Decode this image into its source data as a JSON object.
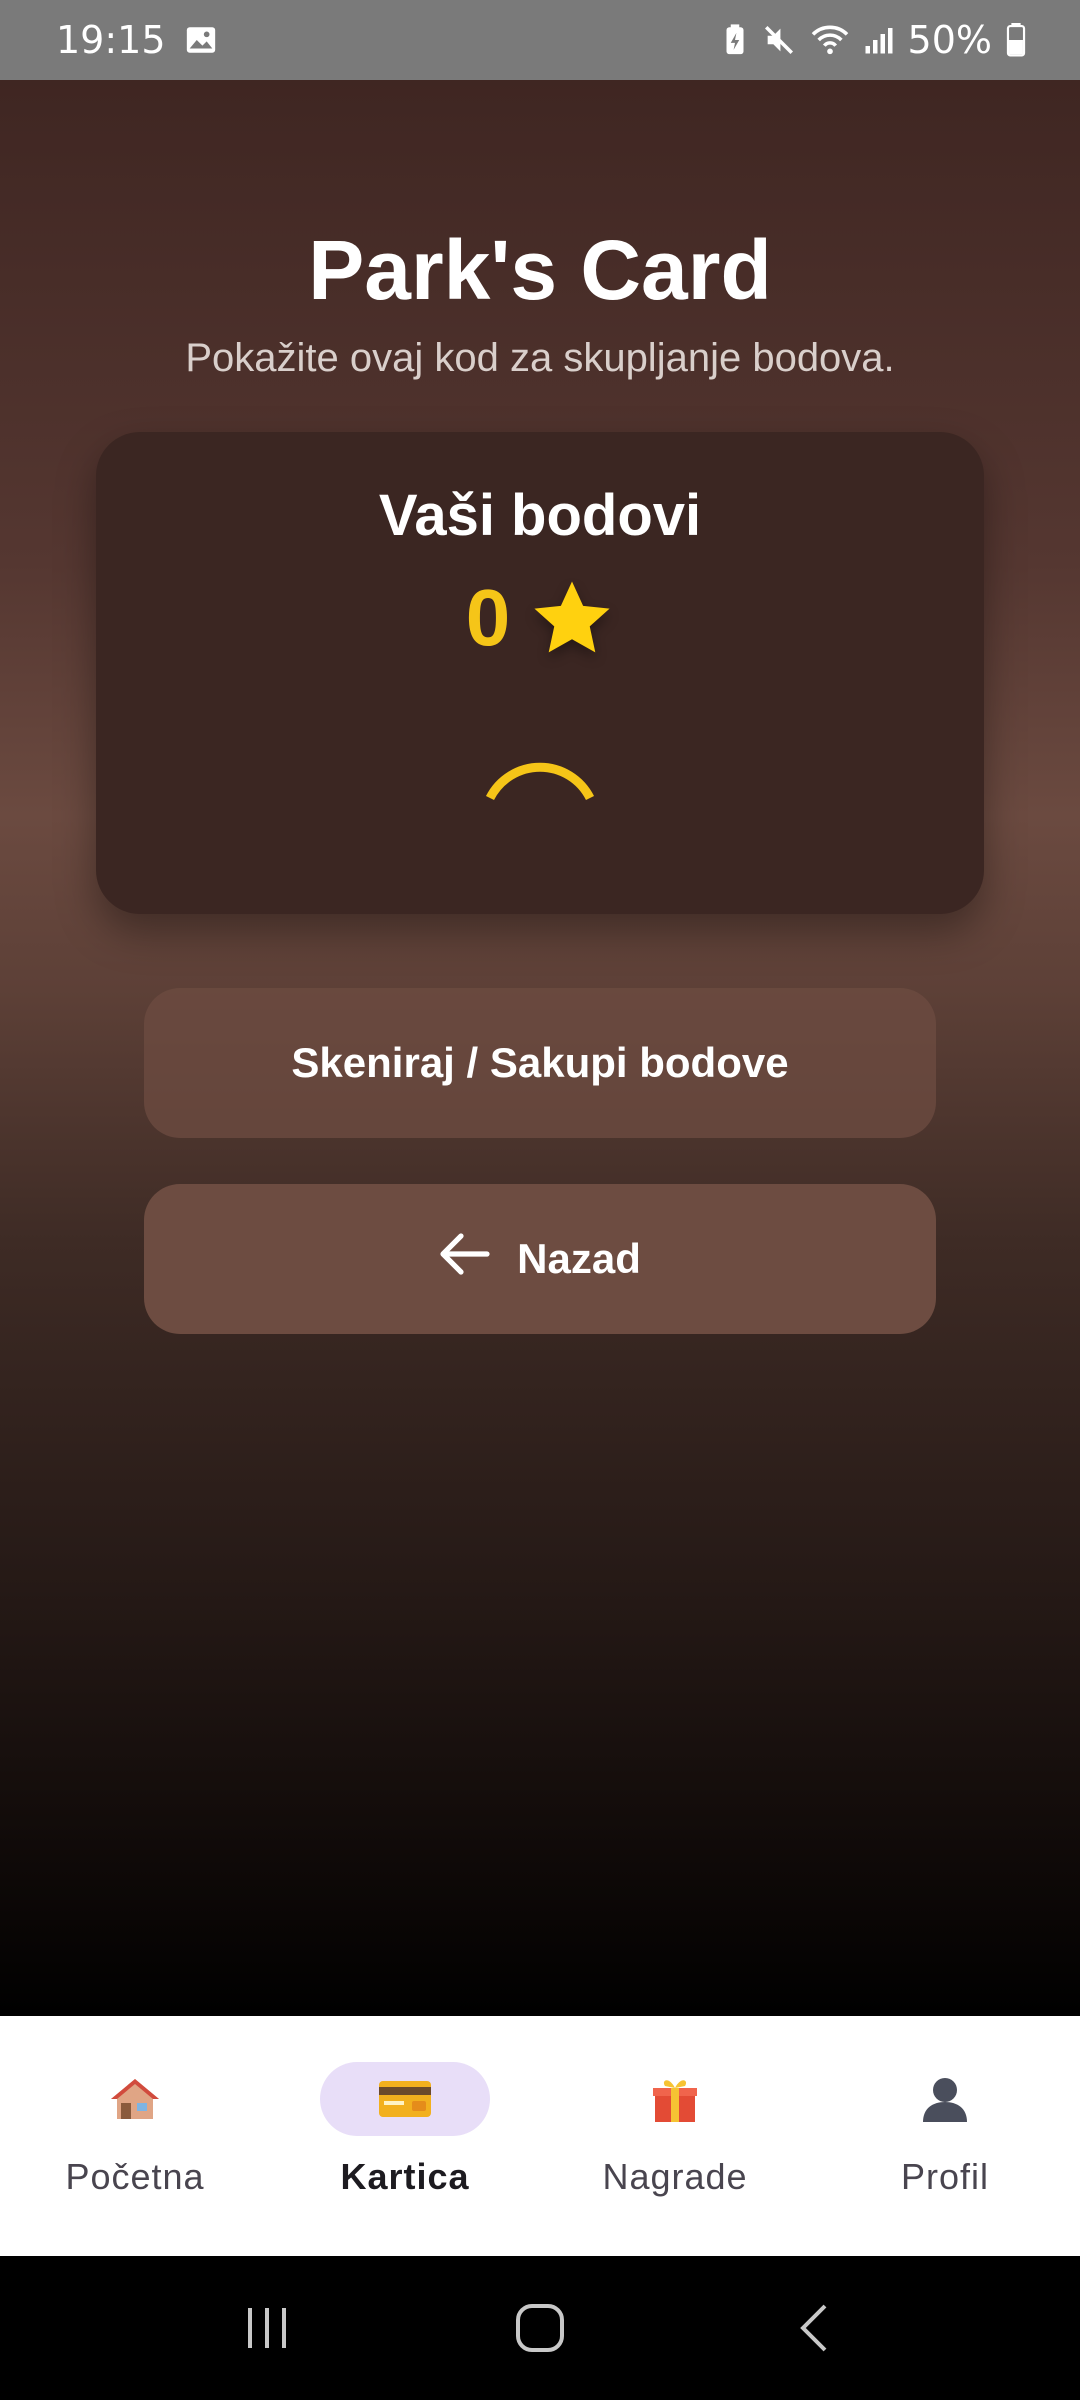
{
  "status_bar": {
    "time": "19:15",
    "battery": "50%",
    "icons": [
      "gallery-icon",
      "battery-saver-icon",
      "mute-icon",
      "wifi-icon",
      "signal-icon",
      "battery-icon"
    ]
  },
  "header": {
    "title": "Park's Card",
    "subtitle": "Pokažite ovaj kod za skupljanje bodova."
  },
  "points_card": {
    "title": "Vaši bodovi",
    "value": "0",
    "icon": "star-icon",
    "loading": true
  },
  "actions": {
    "scan_label": "Skeniraj / Sakupi bodove",
    "back_label": "Nazad",
    "back_icon": "arrow-left-icon"
  },
  "bottom_nav": {
    "items": [
      {
        "label": "Početna",
        "icon": "house-icon",
        "active": false
      },
      {
        "label": "Kartica",
        "icon": "credit-card-icon",
        "active": true
      },
      {
        "label": "Nagrade",
        "icon": "gift-icon",
        "active": false
      },
      {
        "label": "Profil",
        "icon": "person-icon",
        "active": false
      }
    ]
  },
  "colors": {
    "accent": "#F5C518",
    "card_bg": "#3B2622",
    "button_bg": "#6D4C41",
    "active_pill": "#E8DEF8"
  }
}
